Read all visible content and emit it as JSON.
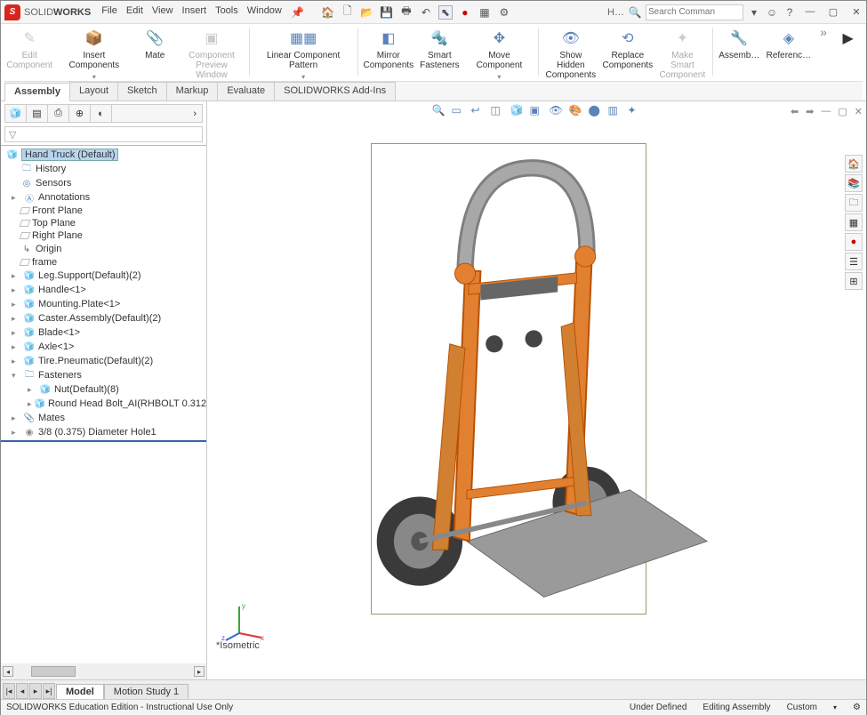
{
  "title": {
    "brand_light": "SOLID",
    "brand_bold": "WORKS"
  },
  "menu": {
    "file": "File",
    "edit": "Edit",
    "view": "View",
    "insert": "Insert",
    "tools": "Tools",
    "window": "Window"
  },
  "search": {
    "placeholder": "Search Comman",
    "label": "H…"
  },
  "ribbon": {
    "edit_component": "Edit\nComponent",
    "insert_components": "Insert Components",
    "mate": "Mate",
    "component_preview": "Component\nPreview Window",
    "lcp": "Linear Component Pattern",
    "mirror": "Mirror\nComponents",
    "smart": "Smart\nFasteners",
    "move": "Move Component",
    "show_hidden": "Show Hidden\nComponents",
    "replace": "Replace\nComponents",
    "make_smart": "Make Smart\nComponent",
    "assemb": "Assemb…",
    "referenc": "Referenc…",
    "tabs": {
      "assembly": "Assembly",
      "layout": "Layout",
      "sketch": "Sketch",
      "markup": "Markup",
      "evaluate": "Evaluate",
      "addins": "SOLIDWORKS Add-Ins"
    }
  },
  "tree": {
    "root": "Hand Truck  (Default)",
    "history": "History",
    "sensors": "Sensors",
    "annotations": "Annotations",
    "front": "Front Plane",
    "top": "Top Plane",
    "right": "Right Plane",
    "origin": "Origin",
    "frame": "frame",
    "leg": "Leg.Support(Default)(2)",
    "handle": "Handle<1>",
    "mplate": "Mounting.Plate<1>",
    "caster": "Caster.Assembly(Default)(2)",
    "blade": "Blade<1>",
    "axle": "Axle<1>",
    "tire": "Tire.Pneumatic(Default)(2)",
    "fasteners": "Fasteners",
    "nut": "Nut(Default)(8)",
    "bolt": "Round Head Bolt_AI(RHBOLT 0.312",
    "mates": "Mates",
    "hole": "3/8 (0.375) Diameter Hole1"
  },
  "view_label": "*Isometric",
  "bottom_tabs": {
    "model": "Model",
    "motion": "Motion Study 1"
  },
  "status": {
    "edition": "SOLIDWORKS Education Edition - Instructional Use Only",
    "under": "Under Defined",
    "editing": "Editing Assembly",
    "custom": "Custom"
  },
  "colors": {
    "accent": "#d9261c",
    "part": "#e0a030",
    "link": "#5a84b8"
  }
}
